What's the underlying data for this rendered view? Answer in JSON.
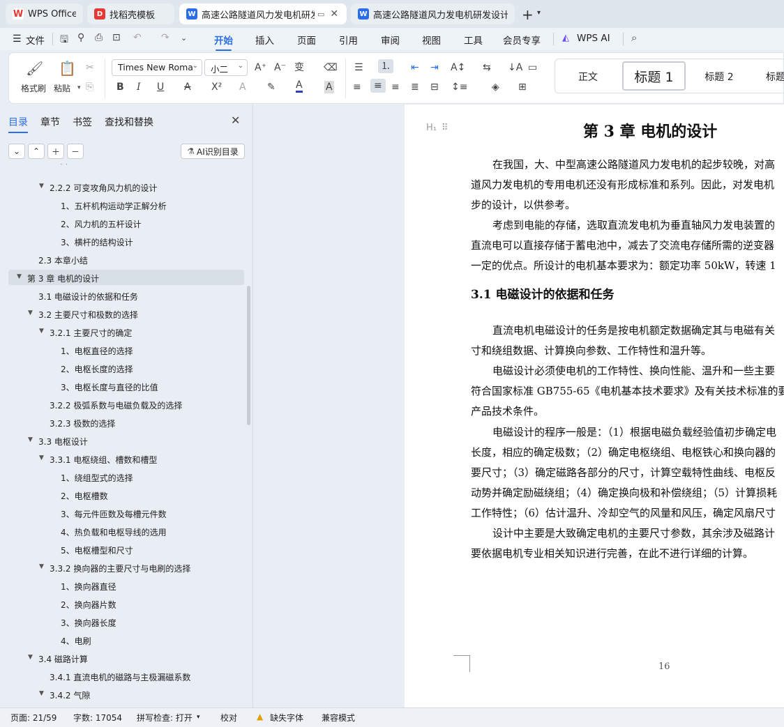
{
  "tabs": [
    {
      "label": "WPS Office",
      "icon": "wps-logo-icon"
    },
    {
      "label": "找稻壳模板",
      "icon": "daoke-icon"
    },
    {
      "label": "高速公路隧道风力发电机研发",
      "icon": "word-doc-icon",
      "active": true
    },
    {
      "label": "高速公路隧道风力发电机研发设计 说",
      "icon": "word-doc-icon"
    }
  ],
  "menubar": {
    "file": "文件",
    "items": [
      "开始",
      "插入",
      "页面",
      "引用",
      "审阅",
      "视图",
      "工具",
      "会员专享"
    ],
    "ai": "WPS AI"
  },
  "ribbon": {
    "format_painter": "格式刷",
    "paste": "粘贴",
    "font_name": "Times New Roma",
    "font_size": "小二",
    "styles": [
      "正文",
      "标题  1",
      "标题  2",
      "标题"
    ]
  },
  "sidebar": {
    "tabs": [
      "目录",
      "章节",
      "书签",
      "查找和替换"
    ],
    "ai_button": "AI识别目录",
    "toc": [
      {
        "text": "2.2.2  可变攻角风力机的设计",
        "level": 3,
        "expanded": true
      },
      {
        "text": "1、五杆机构运动学正解分析",
        "level": 4
      },
      {
        "text": "2、风力机的五杆设计",
        "level": 4
      },
      {
        "text": "3、横杆的结构设计",
        "level": 4
      },
      {
        "text": "2.3  本章小结",
        "level": 2
      },
      {
        "text": "第 3 章  电机的设计",
        "level": 1,
        "expanded": true,
        "selected": true
      },
      {
        "text": "3.1  电磁设计的依据和任务",
        "level": 2
      },
      {
        "text": "3.2  主要尺寸和极数的选择",
        "level": 2,
        "expanded": true
      },
      {
        "text": "3.2.1  主要尺寸的确定",
        "level": 3,
        "expanded": true
      },
      {
        "text": "1、电枢直径的选择",
        "level": 4
      },
      {
        "text": "2、电枢长度的选择",
        "level": 4
      },
      {
        "text": "3、电枢长度与直径的比值",
        "level": 4
      },
      {
        "text": "3.2.2  极弧系数与电磁负载及的选择",
        "level": 3
      },
      {
        "text": "3.2.3  极数的选择",
        "level": 3
      },
      {
        "text": "3.3  电枢设计",
        "level": 2,
        "expanded": true
      },
      {
        "text": "3.3.1  电枢绕组、槽数和槽型",
        "level": 3,
        "expanded": true
      },
      {
        "text": "1、绕组型式的选择",
        "level": 4
      },
      {
        "text": "2、电枢槽数",
        "level": 4
      },
      {
        "text": "3、每元件匝数及每槽元件数",
        "level": 4
      },
      {
        "text": "4、热负载和电枢导线的选用",
        "level": 4
      },
      {
        "text": "5、电枢槽型和尺寸",
        "level": 4
      },
      {
        "text": "3.3.2  换向器的主要尺寸与电刷的选择",
        "level": 3,
        "expanded": true
      },
      {
        "text": "1、换向器直径",
        "level": 4
      },
      {
        "text": "2、换向器片数",
        "level": 4
      },
      {
        "text": "3、换向器长度",
        "level": 4
      },
      {
        "text": "4、电刷",
        "level": 4
      },
      {
        "text": "3.4  磁路计算",
        "level": 2,
        "expanded": true
      },
      {
        "text": "3.4.1  直流电机的磁路与主极漏磁系数",
        "level": 3
      },
      {
        "text": "3.4.2  气隙",
        "level": 3,
        "expanded": true
      }
    ]
  },
  "document": {
    "heading_marker": "H₁",
    "chapter_title": "第 3 章  电机的设计",
    "section_title": "3.1  电磁设计的依据和任务",
    "lines": [
      "在我国，大、中型高速公路隧道风力发电机的起步较晚，对高",
      "道风力发电机的专用电机还没有形成标准和系列。因此，对发电机",
      "步的设计，以供参考。",
      "考虑到电能的存储，选取直流发电机为垂直轴风力发电装置的",
      "直流电可以直接存储于蓄电池中，减去了交流电存储所需的逆变器",
      "一定的优点。所设计的电机基本要求为：额定功率 50kW，转速 1",
      "直流电机电磁设计的任务是按电机额定数据确定其与电磁有关",
      "寸和绕组数据、计算换向参数、工作特性和温升等。",
      "电磁设计必须使电机的工作特性、换向性能、温升和一些主要",
      "符合国家标准 GB755-65《电机基本技术要求》及有关技术标准的要",
      "产品技术条件。",
      "电磁设计的程序一般是：（1）根据电磁负载经验值初步确定电",
      "长度，相应的确定极数；（2）确定电枢绕组、电枢铁心和换向器的",
      "要尺寸；（3）确定磁路各部分的尺寸，计算空载特性曲线、电枢反",
      "动势并确定励磁绕组；（4）确定换向极和补偿绕组；（5）计算损耗",
      "工作特性；（6）估计温升、冷却空气的风量和风压，确定风扇尺寸",
      "设计中主要是大致确定电机的主要尺寸参数，其余涉及磁路计",
      "要依据电机专业相关知识进行完善，在此不进行详细的计算。"
    ],
    "page_number": "16"
  },
  "statusbar": {
    "page": "页面: 21/59",
    "words": "字数: 17054",
    "spell": "拼写检查: 打开",
    "proof": "校对",
    "missing_font": "缺失字体",
    "compat": "兼容模式"
  },
  "colors": {
    "accent": "#2b6de8",
    "selected_row": "#d9dfe6"
  }
}
